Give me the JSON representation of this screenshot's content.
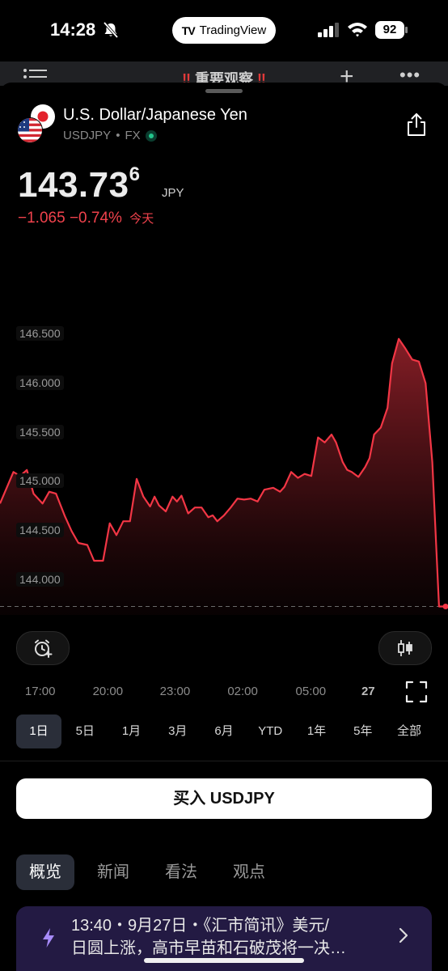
{
  "status_bar": {
    "time": "14:28",
    "app_pill": "TradingView",
    "app_pill_logo": "TV",
    "battery": "92"
  },
  "background_header": {
    "title": "重要观察",
    "title_marks": "‼"
  },
  "symbol": {
    "name": "U.S. Dollar/Japanese Yen",
    "ticker": "USDJPY",
    "separator": "•",
    "exchange": "FX"
  },
  "quote": {
    "price_main": "143.73",
    "price_sup": "6",
    "currency": "JPY",
    "change": "−1.065",
    "change_pct": "−0.74%",
    "period_label": "今天",
    "change_color": "#f0424c"
  },
  "chart_data": {
    "type": "area",
    "title": "",
    "xlabel": "",
    "ylabel": "",
    "ylim": [
      143.65,
      146.85
    ],
    "y_ticks": [
      "146.500",
      "146.000",
      "145.500",
      "145.000",
      "144.500",
      "144.000"
    ],
    "x_ticks": [
      {
        "label": "17:00",
        "x": 5.4
      },
      {
        "label": "20:00",
        "x": 20.5
      },
      {
        "label": "23:00",
        "x": 35.5
      },
      {
        "label": "02:00",
        "x": 50.6
      },
      {
        "label": "05:00",
        "x": 65.8
      },
      {
        "label": "27",
        "x": 80.5,
        "bold": true
      }
    ],
    "baseline": 143.736,
    "line_color": "#f23645",
    "series": [
      {
        "x": [
          0,
          3,
          4.5,
          6,
          7.5,
          9.5,
          11,
          12.5,
          14.5,
          16,
          17.5,
          19.5,
          21,
          23,
          24.5,
          26,
          27.5,
          29,
          30.5,
          32,
          33.5,
          34.5,
          35.5,
          37,
          38.5,
          39.5,
          40.5,
          42,
          43.5,
          45,
          46.5,
          47.5,
          48.5,
          50,
          51.5,
          53,
          54.5,
          56,
          57.5,
          59,
          61,
          62.5,
          63.5,
          65,
          66.5,
          68,
          69.5,
          71,
          72.5,
          74,
          75,
          76.5,
          77.5,
          78.5,
          80,
          81.5,
          82.5,
          83.5,
          85,
          86.5,
          87.5,
          89,
          90.5,
          92,
          93.5,
          95,
          96.5,
          98,
          99,
          100
        ],
        "y": [
          144.78,
          145.1,
          145.06,
          145.12,
          144.88,
          144.78,
          144.9,
          144.88,
          144.65,
          144.5,
          144.38,
          144.36,
          144.2,
          144.2,
          144.58,
          144.46,
          144.6,
          144.6,
          145.03,
          144.85,
          144.75,
          144.85,
          144.76,
          144.7,
          144.85,
          144.8,
          144.86,
          144.68,
          144.74,
          144.74,
          144.64,
          144.66,
          144.6,
          144.66,
          144.74,
          144.83,
          144.82,
          144.83,
          144.8,
          144.92,
          144.94,
          144.9,
          144.95,
          145.1,
          145.04,
          145.08,
          145.06,
          145.45,
          145.4,
          145.48,
          145.4,
          145.2,
          145.12,
          145.1,
          145.05,
          145.15,
          145.24,
          145.48,
          145.55,
          145.75,
          146.2,
          146.45,
          146.35,
          146.24,
          146.22,
          146.0,
          145.2,
          143.736,
          143.736,
          143.736
        ]
      }
    ],
    "grid": false,
    "legend": "none"
  },
  "chart_controls": {
    "alarm_icon": "alarm-plus-icon",
    "chart_type_icon": "candlestick-icon",
    "fullscreen_icon": "fullscreen-icon"
  },
  "ranges": [
    {
      "label": "1日",
      "active": true
    },
    {
      "label": "5日"
    },
    {
      "label": "1月"
    },
    {
      "label": "3月"
    },
    {
      "label": "6月"
    },
    {
      "label": "YTD"
    },
    {
      "label": "1年"
    },
    {
      "label": "5年"
    },
    {
      "label": "全部"
    }
  ],
  "buy_button": "买入 USDJPY",
  "tabs": [
    {
      "label": "概览",
      "active": true
    },
    {
      "label": "新闻"
    },
    {
      "label": "看法"
    },
    {
      "label": "观点"
    }
  ],
  "news": {
    "line1": "13:40・9月27日・《汇市简讯》美元/",
    "line2": "日圆上涨，高市早苗和石破茂将一决…"
  },
  "colors": {
    "accent_red": "#f23645",
    "background": "#000000",
    "news_bg": "#231a43",
    "chip_bg": "#2a2e39"
  }
}
